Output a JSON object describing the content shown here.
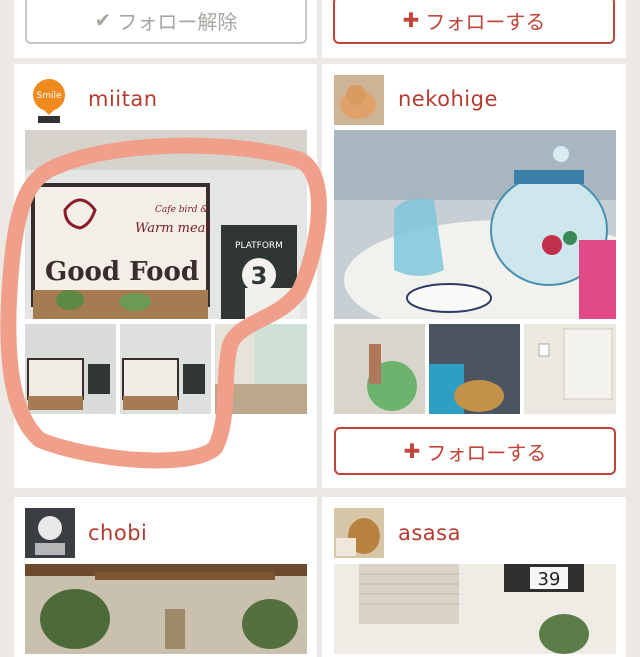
{
  "top_buttons": {
    "unfollow": {
      "icon": "checkmark-icon",
      "label": "フォロー解除"
    },
    "follow": {
      "icon": "plus-icon",
      "label": "フォローする"
    }
  },
  "users": [
    {
      "username": "miitan",
      "avatar_badge": "Smile"
    },
    {
      "username": "nekohige",
      "follow_label": "フォローする"
    },
    {
      "username": "chobi"
    },
    {
      "username": "asasa"
    }
  ],
  "photo_text": {
    "sign_line1": "Cafe bird &",
    "sign_line2": "Warm meal",
    "sign_main": "Good Food",
    "platform_label": "PLATFORM",
    "platform_number": "3",
    "counter_digits": "39"
  },
  "colors": {
    "accent": "#c1443a",
    "muted": "#a9a6a1",
    "background": "#ece9e4",
    "highlight_stroke": "#f0a08a"
  }
}
